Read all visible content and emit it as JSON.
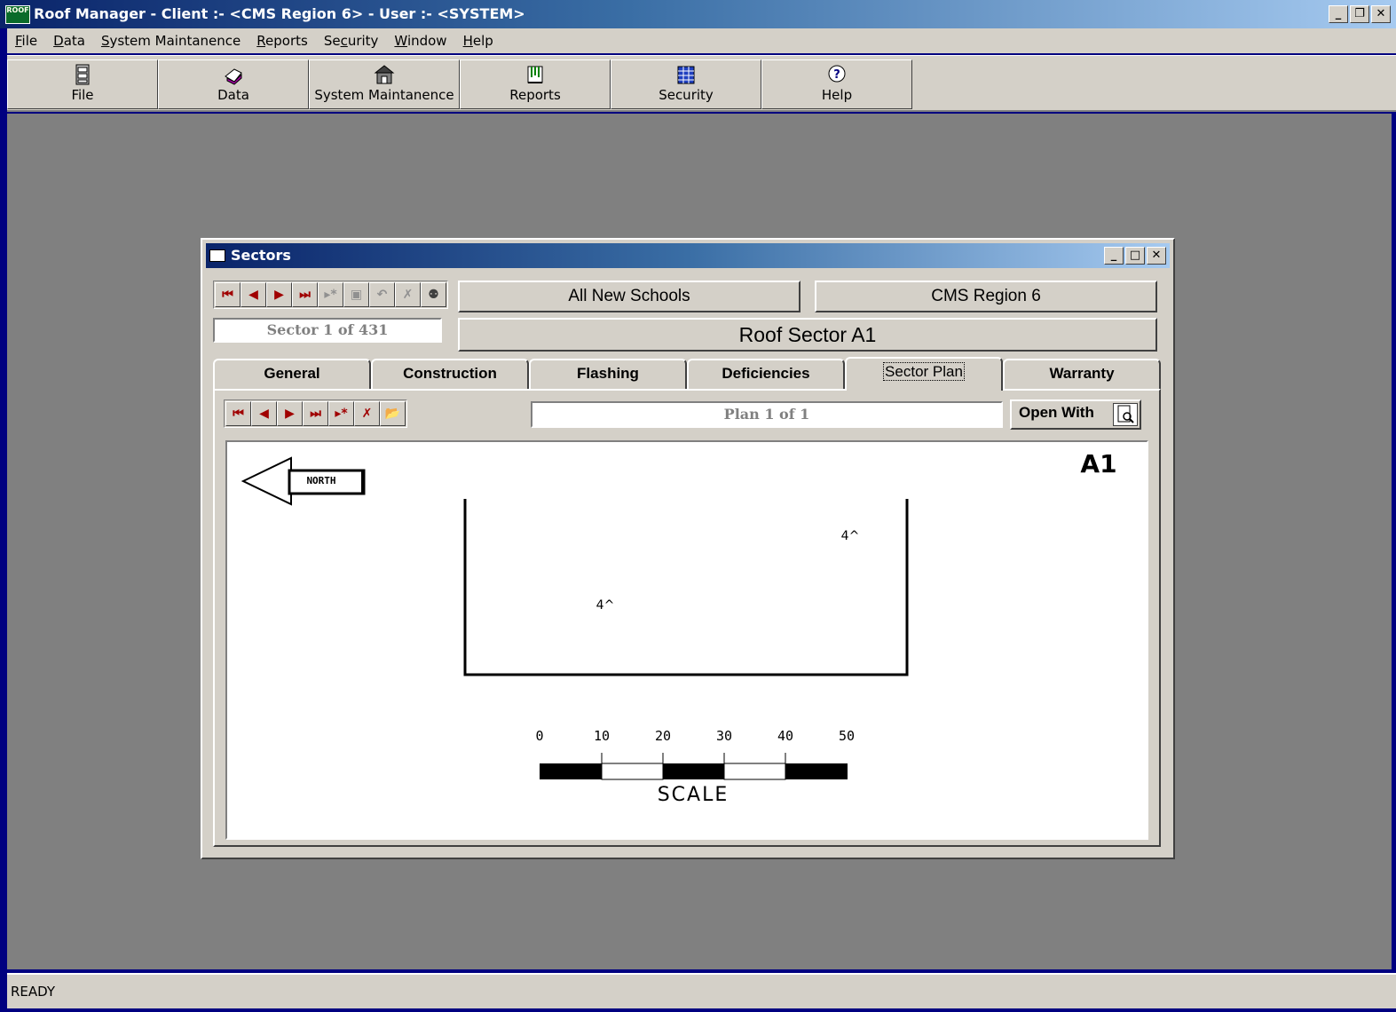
{
  "app": {
    "title": "Roof Manager - Client :- <CMS Region 6> - User :- <SYSTEM>",
    "icon_text": "ROOF"
  },
  "window_buttons": {
    "minimize": "_",
    "restore": "ф",
    "close": "✕"
  },
  "menu": [
    {
      "u": "F",
      "rest": "ile"
    },
    {
      "u": "D",
      "rest": "ata"
    },
    {
      "u": "S",
      "rest": "ystem Maintanence"
    },
    {
      "u": "R",
      "rest": "eports"
    },
    {
      "u": "",
      "pre": "Se",
      "u2": "c",
      "rest": "urity"
    },
    {
      "u": "W",
      "rest": "indow"
    },
    {
      "u": "H",
      "rest": "elp"
    }
  ],
  "toolbar": {
    "file": "File",
    "data": "Data",
    "system_maintanence": "System Maintanence",
    "reports": "Reports",
    "security": "Security",
    "help": "Help"
  },
  "status": {
    "text": "READY"
  },
  "sectors": {
    "title": "Sectors",
    "group": "All New Schools",
    "client": "CMS Region 6",
    "record": "Sector  1 of 431",
    "sector_name": "Roof Sector A1",
    "tabs": {
      "general": "General",
      "construction": "Construction",
      "flashing": "Flashing",
      "deficiencies": "Deficiencies",
      "sector_plan": "Sector Plan",
      "warranty": "Warranty"
    },
    "plan_record": "Plan 1 of 1",
    "open_with": "Open With"
  },
  "plan": {
    "label": "A1",
    "north_label": "NORTH",
    "drain_1": "4^",
    "drain_2": "4^",
    "scale_title": "SCALE",
    "scale_ticks": [
      "0",
      "10",
      "20",
      "30",
      "40",
      "50"
    ]
  },
  "colors": {
    "desktop": "#000080",
    "face": "#d4d0c8",
    "mdi": "#808080",
    "nav_red": "#a00000"
  }
}
